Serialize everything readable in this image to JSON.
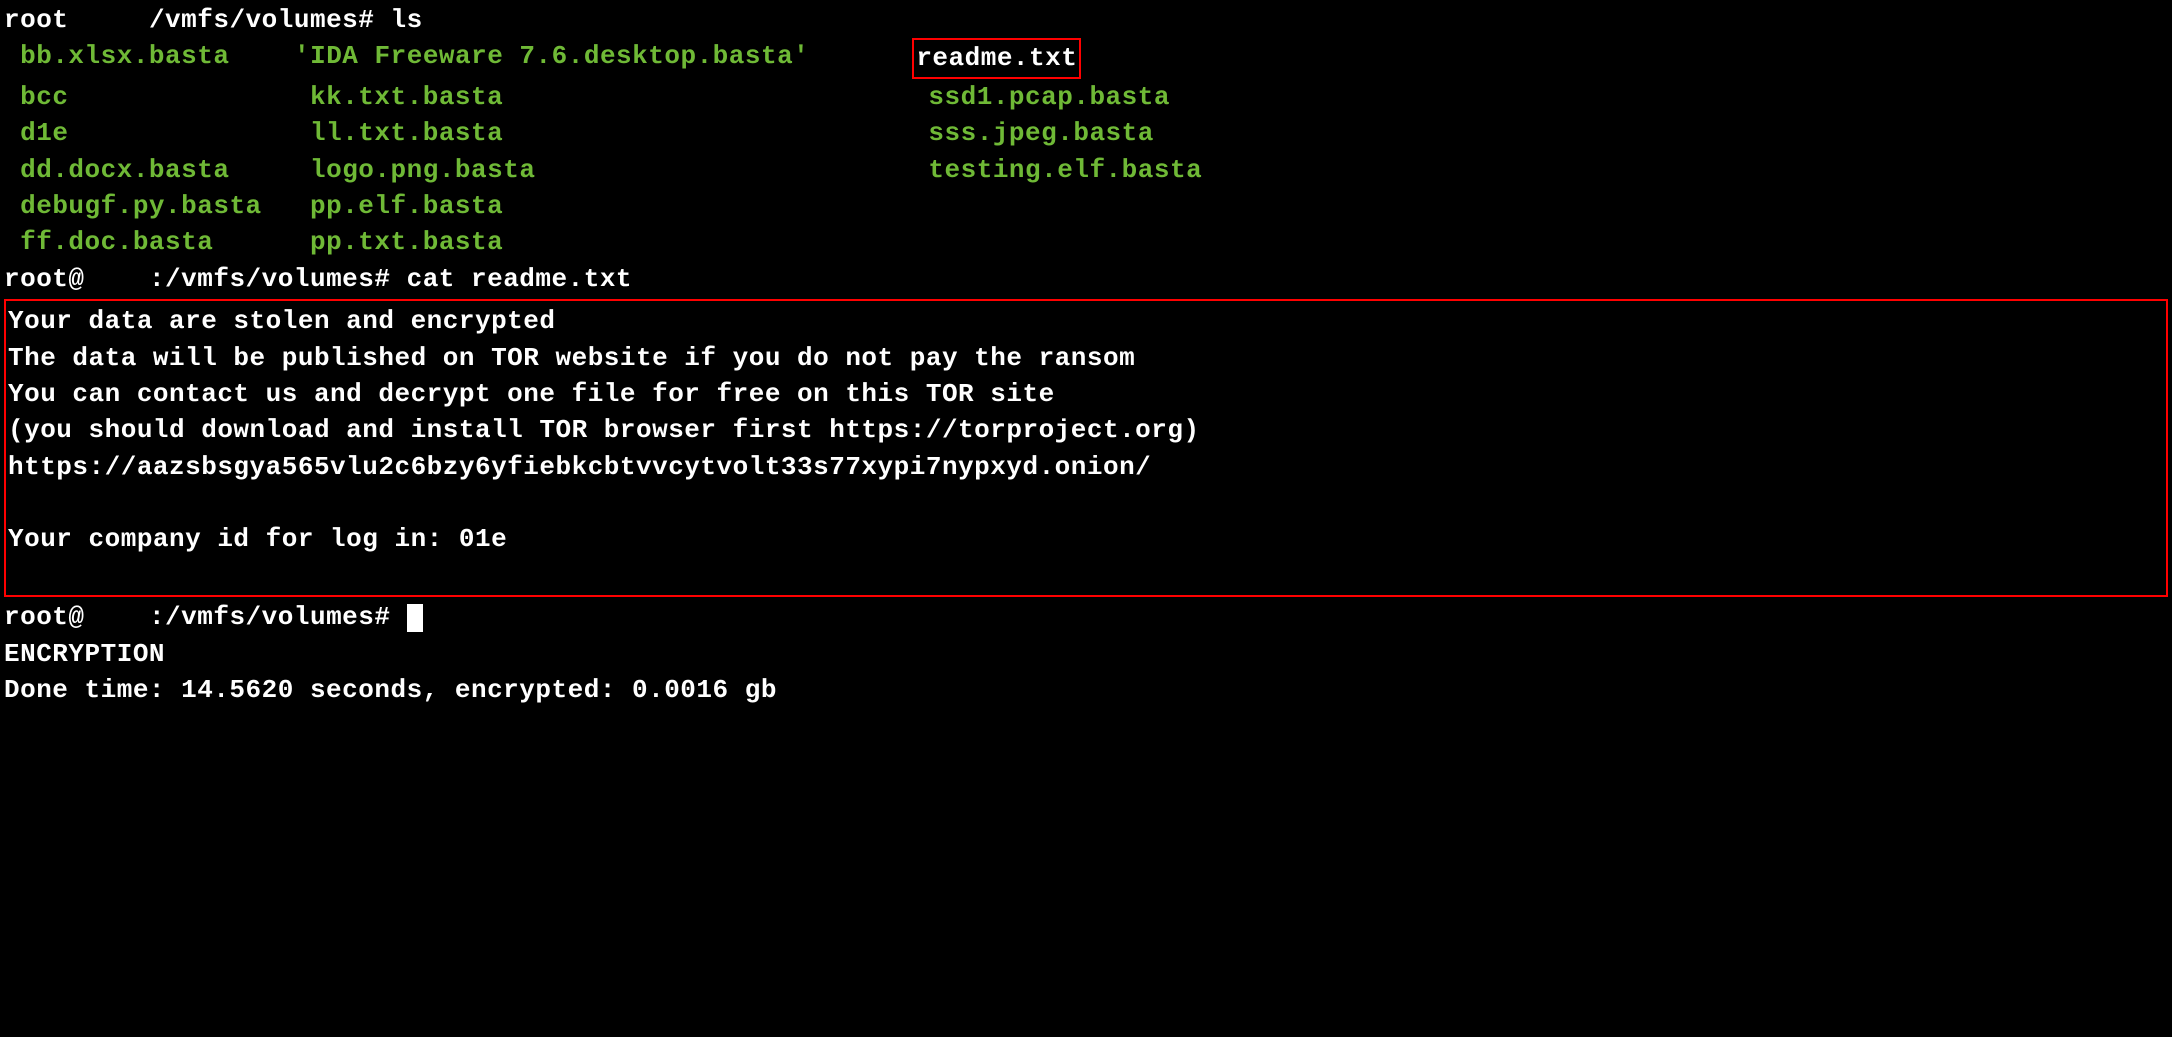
{
  "prompts": {
    "line1": {
      "user": "root",
      "path": "/vmfs/volumes#",
      "cmd": "ls"
    },
    "line2": {
      "user": "root@",
      "path": ":/vmfs/volumes#",
      "cmd": "cat readme.txt"
    },
    "line3": {
      "user": "root@",
      "path": ":/vmfs/volumes#",
      "cmd": ""
    }
  },
  "files": {
    "row1": {
      "c1": "bb.xlsx.basta",
      "c2": "'IDA Freeware 7.6.desktop.basta'",
      "c3": "readme.txt"
    },
    "row2": {
      "c1": "bcc",
      "c2": "kk.txt.basta",
      "c3": "ssd1.pcap.basta"
    },
    "row3": {
      "c1": "d1e",
      "c2": "ll.txt.basta",
      "c3": "sss.jpeg.basta"
    },
    "row4": {
      "c1": "dd.docx.basta",
      "c2": "logo.png.basta",
      "c3": "testing.elf.basta"
    },
    "row5": {
      "c1": "debugf.py.basta",
      "c2": "pp.elf.basta",
      "c3": ""
    },
    "row6": {
      "c1": "ff.doc.basta",
      "c2": "pp.txt.basta",
      "c3": ""
    }
  },
  "ransom": {
    "l1": "Your data are stolen and encrypted",
    "l2": "The data will be published on TOR website if you do not pay the ransom",
    "l3": "You can contact us and decrypt one file for free on this TOR site",
    "l4": "(you should download and install TOR browser first https://torproject.org)",
    "l5": "https://aazsbsgya565vlu2c6bzy6yfiebkcbtvvcytvolt33s77xypi7nypxyd.onion/",
    "l6": "",
    "l7": "Your company id for log in: 01e"
  },
  "status": {
    "l1": "ENCRYPTION",
    "l2": "Done time: 14.5620 seconds, encrypted: 0.0016 gb"
  }
}
